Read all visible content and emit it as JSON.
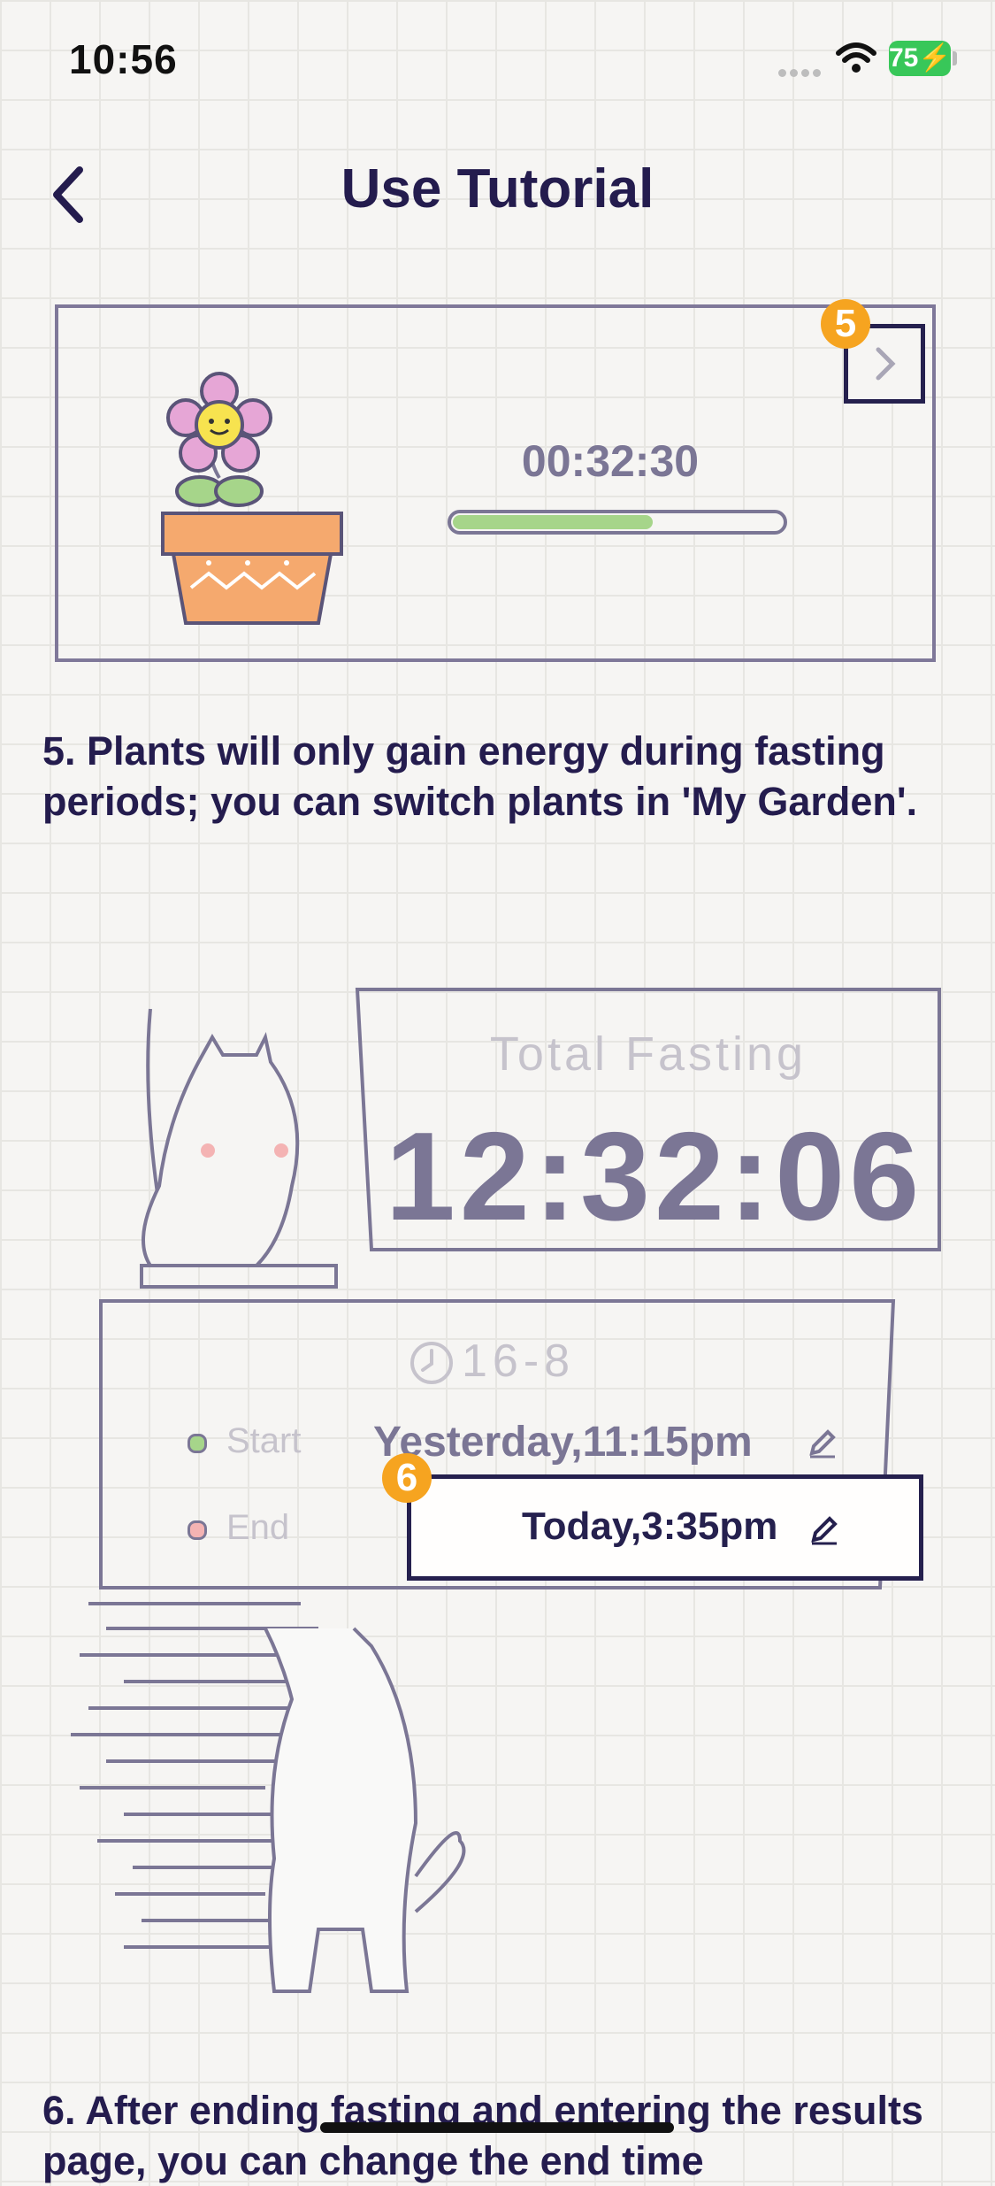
{
  "status_bar": {
    "time": "10:56",
    "battery": "75"
  },
  "header": {
    "title": "Use Tutorial"
  },
  "step5": {
    "badge": "5",
    "timer": "00:32:30",
    "progress": 0.6,
    "text": "5. Plants will only gain energy during fasting periods; you can switch plants in 'My Garden'."
  },
  "step6": {
    "badge": "6",
    "total_label": "Total Fasting",
    "total_time": "12:32:06",
    "plan": "16-8",
    "start_label": "Start",
    "start_value": "Yesterday,11:15pm",
    "end_label": "End",
    "end_value": "Today,3:35pm",
    "text": "6. After ending fasting and entering the results page, you can change the end time"
  },
  "colors": {
    "accent": "#f6a420",
    "ink": "#25204e",
    "progress": "#a6d58a",
    "battery": "#38c759"
  }
}
